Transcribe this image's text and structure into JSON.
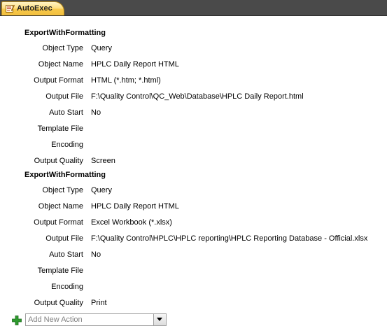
{
  "tab": {
    "label": "AutoExec"
  },
  "actions": [
    {
      "name": "ExportWithFormatting",
      "args": [
        {
          "label": "Object Type",
          "value": "Query"
        },
        {
          "label": "Object Name",
          "value": "HPLC Daily Report HTML"
        },
        {
          "label": "Output Format",
          "value": "HTML (*.htm; *.html)"
        },
        {
          "label": "Output File",
          "value": "F:\\Quality Control\\QC_Web\\Database\\HPLC Daily Report.html"
        },
        {
          "label": "Auto Start",
          "value": "No"
        },
        {
          "label": "Template File",
          "value": ""
        },
        {
          "label": "Encoding",
          "value": ""
        },
        {
          "label": "Output Quality",
          "value": "Screen"
        }
      ]
    },
    {
      "name": "ExportWithFormatting",
      "args": [
        {
          "label": "Object Type",
          "value": "Query"
        },
        {
          "label": "Object Name",
          "value": "HPLC Daily Report HTML"
        },
        {
          "label": "Output Format",
          "value": "Excel Workbook (*.xlsx)"
        },
        {
          "label": "Output File",
          "value": "F:\\Quality Control\\HPLC\\HPLC reporting\\HPLC Reporting Database - Official.xlsx"
        },
        {
          "label": "Auto Start",
          "value": "No"
        },
        {
          "label": "Template File",
          "value": ""
        },
        {
          "label": "Encoding",
          "value": ""
        },
        {
          "label": "Output Quality",
          "value": "Print"
        }
      ]
    }
  ],
  "add_action": {
    "placeholder": "Add New Action"
  },
  "colors": {
    "tab_accent": "#f7c84a",
    "tabstrip": "#4a4a4a",
    "plus_icon": "#2e9a2e"
  }
}
